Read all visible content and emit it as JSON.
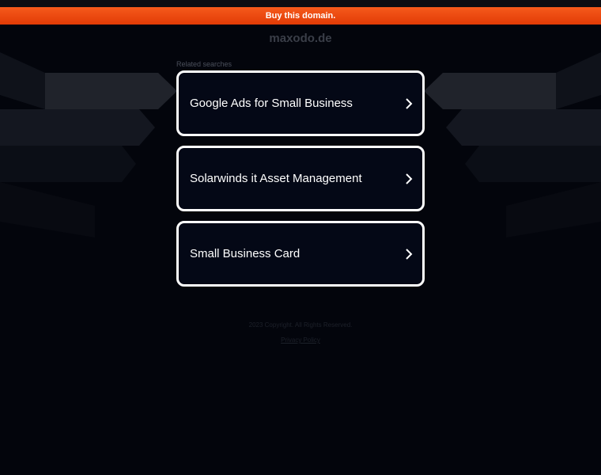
{
  "banner": {
    "buy_label": "Buy this domain."
  },
  "header": {
    "domain": "maxodo.de"
  },
  "related": {
    "label": "Related searches",
    "items": [
      {
        "label": "Google Ads for Small Business"
      },
      {
        "label": "Solarwinds it Asset Management"
      },
      {
        "label": "Small Business Card"
      }
    ]
  },
  "footer": {
    "copyright": "2023 Copyright. All Rights Reserved.",
    "privacy_label": "Privacy Policy"
  },
  "colors": {
    "background": "#03050c",
    "accent": "#e8430a",
    "card_border": "#ffffff",
    "card_bg": "#040816"
  },
  "icons": {
    "result_arrow": "chevron-right-icon"
  }
}
